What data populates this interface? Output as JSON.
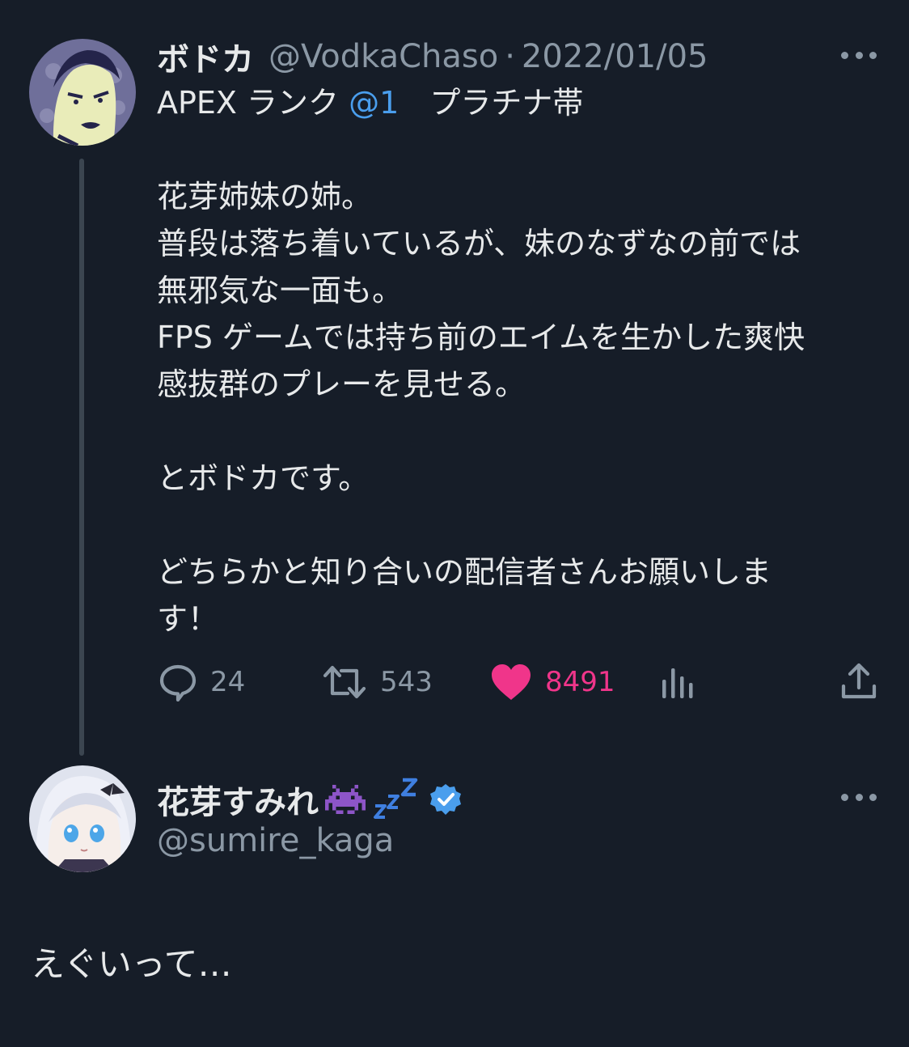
{
  "parent_tweet": {
    "display_name": "ボドカ",
    "handle": "@VodkaChaso",
    "separator": "·",
    "date": "2022/01/05",
    "text_line1_prefix": "APEX ランク ",
    "text_line1_mention": "@1",
    "text_line1_suffix": "　プラチナ帯",
    "body_lines": [
      "花芽姉妹の姉。",
      "普段は落ち着いているが、妹のなずなの前では",
      "無邪気な一面も。",
      "FPS ゲームでは持ち前のエイムを生かした爽快",
      "感抜群のプレーを見せる。",
      "とボドカです。",
      "どちらかと知り合いの配信者さんお願いしま",
      "す！"
    ],
    "reply_count": "24",
    "retweet_count": "543",
    "like_count": "8491"
  },
  "reply_tweet": {
    "display_name": "花芽すみれ",
    "name_emoji": [
      "space-invader-icon",
      "zzz-icon"
    ],
    "verified": true,
    "handle": "@sumire_kaga",
    "text": "えぐいって…"
  },
  "colors": {
    "background": "#161d28",
    "text": "#e7e9ea",
    "muted": "#8b98a5",
    "link": "#4a9eed",
    "like": "#f0358a",
    "verified": "#4a9eed"
  }
}
